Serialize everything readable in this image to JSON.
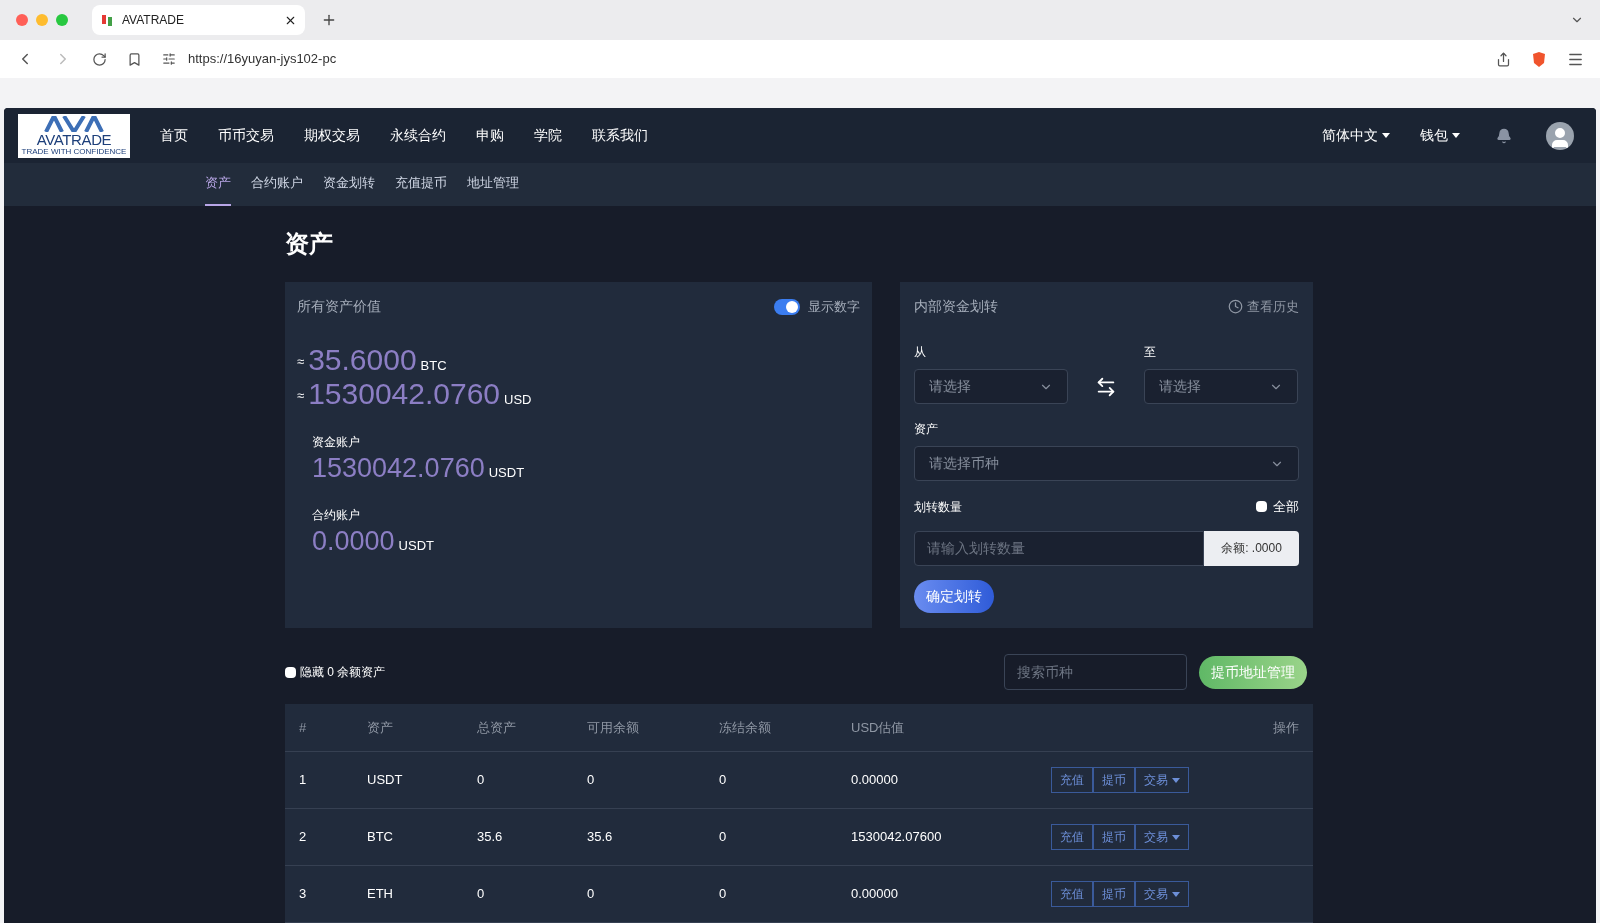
{
  "browser": {
    "tab_title": "AVATRADE",
    "url": "https://16yuyan-jys102-pc"
  },
  "nav": {
    "logo": "AVATRADE",
    "logo_tagline": "TRADE WITH CONFIDENCE",
    "items": [
      "首页",
      "币币交易",
      "期权交易",
      "永续合约",
      "申购",
      "学院",
      "联系我们"
    ],
    "language": "简体中文",
    "wallet": "钱包"
  },
  "subnav": [
    {
      "label": "资产",
      "selected": true
    },
    {
      "label": "合约账户",
      "selected": false
    },
    {
      "label": "资金划转",
      "selected": false
    },
    {
      "label": "充值提币",
      "selected": false
    },
    {
      "label": "地址管理",
      "selected": false
    }
  ],
  "page_title": "资产",
  "total_card": {
    "title": "所有资产价值",
    "toggle": {
      "label": "显示数字",
      "on": true
    },
    "totals": [
      {
        "approx": "≈",
        "value": "35.6000",
        "unit": "BTC"
      },
      {
        "approx": "≈",
        "value": "1530042.0760",
        "unit": "USD"
      }
    ],
    "accounts": [
      {
        "label": "资金账户",
        "value": "1530042.0760",
        "unit": "USDT"
      },
      {
        "label": "合约账户",
        "value": "0.0000",
        "unit": "USDT"
      }
    ]
  },
  "transfer_card": {
    "title": "内部资金划转",
    "history": "查看历史",
    "from_label": "从",
    "from_placeholder": "请选择",
    "to_label": "至",
    "to_placeholder": "请选择",
    "asset_label": "资产",
    "asset_placeholder": "请选择币种",
    "amount_label": "划转数量",
    "all": {
      "label": "全部",
      "checked": false
    },
    "amount_placeholder": "请输入划转数量",
    "balance": "余额: .0000",
    "submit": "确定划转"
  },
  "hide_zero": {
    "label": "隐藏 0 余额资产",
    "checked": false
  },
  "search_placeholder": "搜索币种",
  "address_button": "提币地址管理",
  "table": {
    "columns": [
      "#",
      "资产",
      "总资产",
      "可用余额",
      "冻结余额",
      "USD估值",
      "操作"
    ],
    "rows": [
      {
        "cells": [
          "1",
          "USDT",
          "0",
          "0",
          "0",
          "0.00000"
        ],
        "actions": [
          "充值",
          "提币",
          "交易"
        ]
      },
      {
        "cells": [
          "2",
          "BTC",
          "35.6",
          "35.6",
          "0",
          "1530042.07600"
        ],
        "actions": [
          "充值",
          "提币",
          "交易"
        ]
      },
      {
        "cells": [
          "3",
          "ETH",
          "0",
          "0",
          "0",
          "0.00000"
        ],
        "actions": [
          "充值",
          "提币",
          "交易"
        ]
      }
    ]
  }
}
